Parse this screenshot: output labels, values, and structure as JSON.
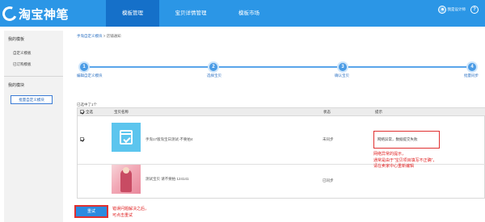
{
  "header": {
    "logo_text": "淘宝神笔",
    "nav": [
      "模板管理",
      "宝贝详情管理",
      "模板市场"
    ],
    "active_nav": "模板管理",
    "user_label": "我是设计师"
  },
  "sidebar": {
    "group1": "我的模板",
    "items": [
      "自定义模板",
      "已订购模板"
    ],
    "group2": "我的模块",
    "button_label": "批量自定义模块"
  },
  "breadcrumb": {
    "parent": "手淘自定义模块",
    "separator": " > ",
    "current": "店铺通知"
  },
  "steps": [
    {
      "num": "1",
      "label": "编辑自定义模块"
    },
    {
      "num": "2",
      "label": "选择宝贝"
    },
    {
      "num": "3",
      "label": "确认宝贝"
    },
    {
      "num": "4",
      "label": "批量同步"
    }
  ],
  "table": {
    "selected_text": "已选中了1个",
    "headers": {
      "select": "全选",
      "name": "宝贝名称",
      "status": "状态",
      "note": "提示"
    },
    "rows": [
      {
        "checked": true,
        "name": "手淘17版淘宝日测试-不要拍4",
        "status": "未同步",
        "note": "网络异常，数据提交失败"
      },
      {
        "checked": false,
        "name": "测试宝贝 请不要拍 124141",
        "status": "已同步",
        "note": ""
      }
    ]
  },
  "annotations": {
    "note_right": [
      "网络异常的提示，",
      "通常是由于“宝贝项目填写不正确”，",
      "请在卖家中心重新编辑"
    ],
    "note_bottom": [
      "错误问题解决之后，",
      "可点击重试"
    ]
  },
  "footer": {
    "retry_label": "重试"
  },
  "colors": {
    "header_bg": "#2b96e6",
    "active_nav": "#1570c9",
    "annotation": "#e02020",
    "step": "#4a9be5"
  },
  "icons": [
    "logo-icon",
    "user-avatar-icon",
    "help-icon",
    "calendar-check-icon"
  ]
}
